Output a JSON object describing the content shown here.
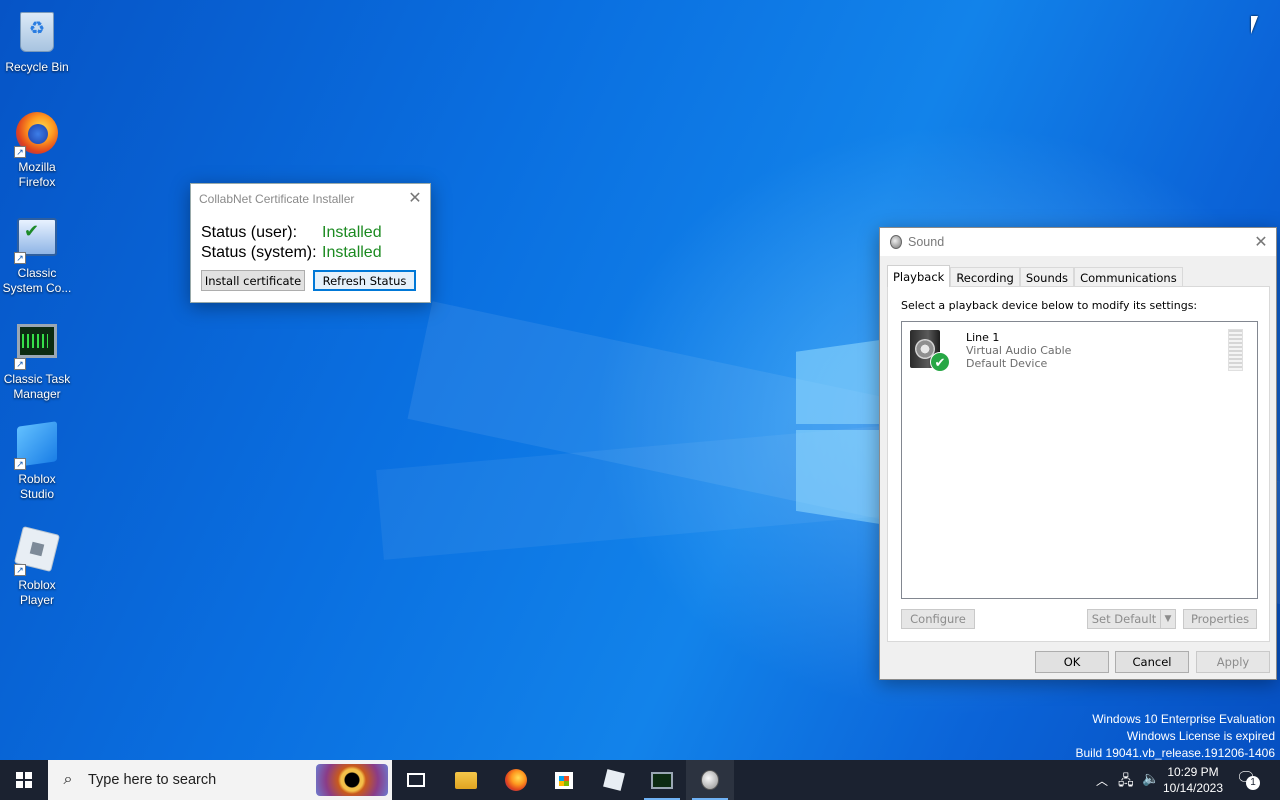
{
  "desktop": {
    "icons": [
      {
        "label": "Recycle Bin",
        "icon": "recycle-bin-icon"
      },
      {
        "label": "Mozilla Firefox",
        "icon": "firefox-icon"
      },
      {
        "label": "Classic System Co...",
        "icon": "control-panel-icon"
      },
      {
        "label": "Classic Task Manager",
        "icon": "task-manager-icon"
      },
      {
        "label": "Roblox Studio",
        "icon": "roblox-studio-icon"
      },
      {
        "label": "Roblox Player",
        "icon": "roblox-player-icon"
      }
    ],
    "watermark": {
      "line1": "Windows 10 Enterprise Evaluation",
      "line2": "Windows License is expired",
      "line3": "Build 19041.vb_release.191206-1406"
    }
  },
  "collabnet": {
    "title": "CollabNet Certificate Installer",
    "status_user_label": "Status (user):",
    "status_user_value": "Installed",
    "status_system_label": "Status (system):",
    "status_system_value": "Installed",
    "install_label": "Install certificate",
    "refresh_label": "Refresh Status",
    "status_color": "#1b8a20"
  },
  "sound": {
    "title": "Sound",
    "tabs": [
      {
        "label": "Playback",
        "active": true
      },
      {
        "label": "Recording",
        "active": false
      },
      {
        "label": "Sounds",
        "active": false
      },
      {
        "label": "Communications",
        "active": false
      }
    ],
    "caption": "Select a playback device below to modify its settings:",
    "devices": [
      {
        "name": "Line 1",
        "type": "Virtual Audio Cable",
        "status": "Default Device"
      }
    ],
    "configure_label": "Configure",
    "set_default_label": "Set Default",
    "properties_label": "Properties",
    "ok_label": "OK",
    "cancel_label": "Cancel",
    "apply_label": "Apply"
  },
  "taskbar": {
    "search_placeholder": "Type here to search",
    "apps": [
      {
        "name": "task-view",
        "running": false
      },
      {
        "name": "file-explorer",
        "running": false
      },
      {
        "name": "firefox",
        "running": false
      },
      {
        "name": "microsoft-store",
        "running": false
      },
      {
        "name": "roblox-player",
        "running": false
      },
      {
        "name": "classic-task-manager",
        "running": true
      },
      {
        "name": "sound",
        "running": true
      }
    ],
    "time": "10:29 PM",
    "date": "10/14/2023",
    "notification_count": "1",
    "accent_color": "#0078d7"
  }
}
